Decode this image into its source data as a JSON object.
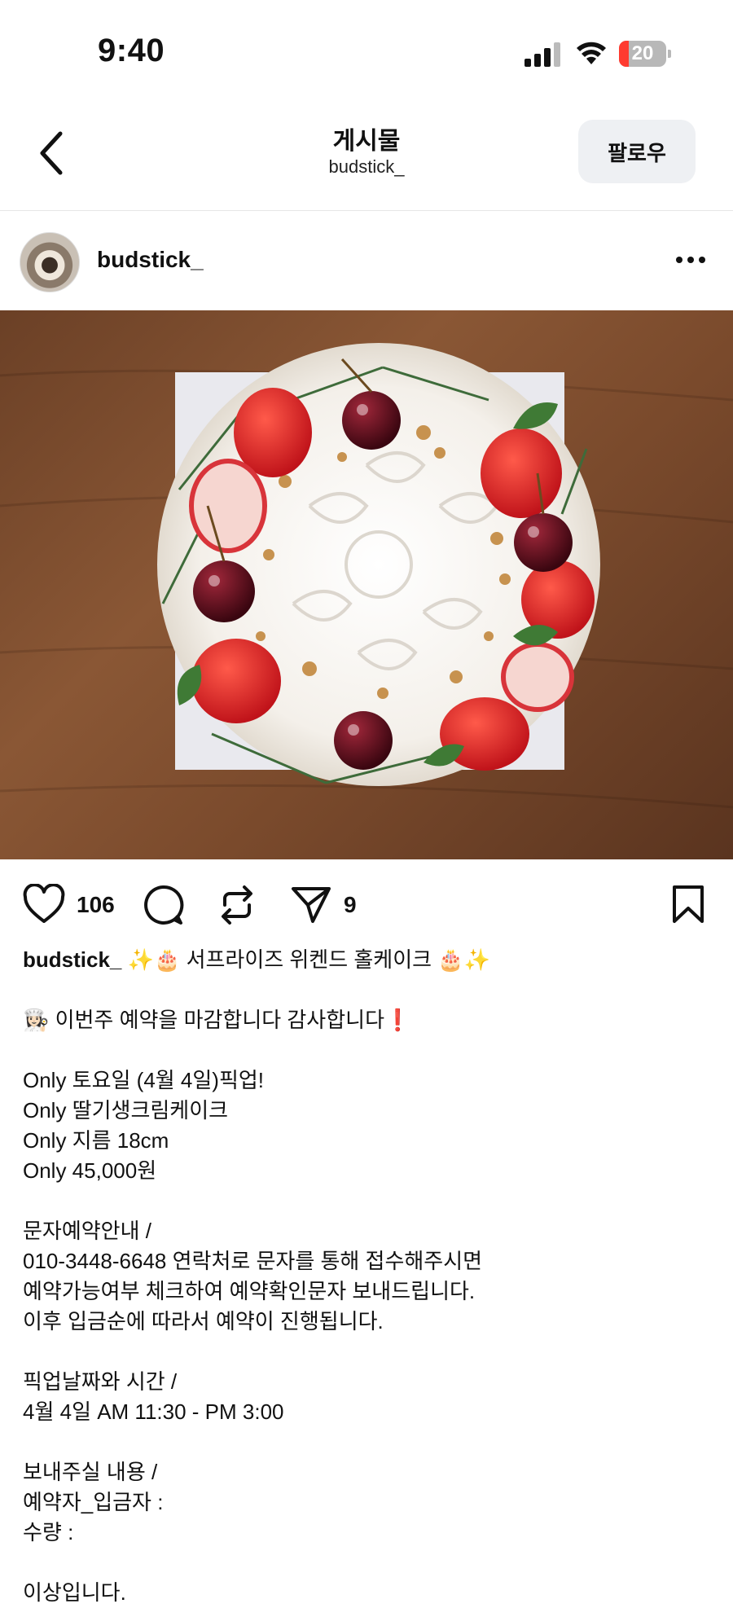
{
  "status_bar": {
    "time": "9:40",
    "battery": "20",
    "battery_level": 0.2,
    "battery_color": "#ff3b30"
  },
  "header": {
    "title": "게시물",
    "subtitle": "budstick_",
    "follow_label": "팔로우"
  },
  "post": {
    "author": "budstick_",
    "likes": "106",
    "shares": "9"
  },
  "caption": {
    "username": "budstick_",
    "title": " ✨🎂 서프라이즈 위켄드 홀케이크 🎂✨",
    "lines": [
      "",
      "👩🏻‍🍳 이번주 예약을 마감합니다 감사합니다❗",
      "",
      "Only 토요일 (4월 4일)픽업!",
      "Only 딸기생크림케이크",
      "Only 지름 18cm",
      "Only 45,000원",
      "",
      "문자예약안내 /",
      "010-3448-6648 연락처로 문자를 통해 접수해주시면",
      "예약가능여부 체크하여 예약확인문자 보내드립니다.",
      "이후 입금순에 따라서 예약이 진행됩니다.",
      "",
      "픽업날짜와 시간 /",
      "4월 4일 AM 11:30 - PM 3:00",
      "",
      "보내주실 내용 /",
      "예약자_입금자 :",
      "수량 :",
      "",
      "이상입니다."
    ]
  },
  "icons": {
    "back": "chevron-left-icon",
    "more": "more-dots-icon",
    "like": "heart-icon",
    "comment": "comment-icon",
    "repost": "repost-icon",
    "share": "send-icon",
    "save": "bookmark-icon"
  }
}
